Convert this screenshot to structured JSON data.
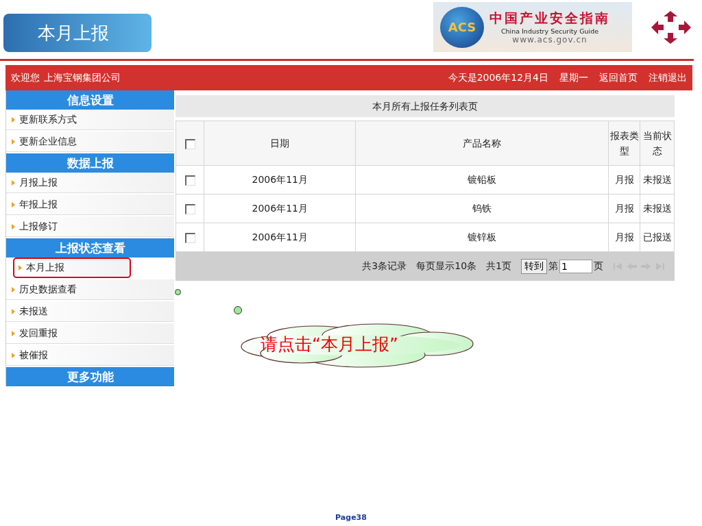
{
  "slide": {
    "title": "本月上报",
    "page": "Page38"
  },
  "logo": {
    "badge": "ACS",
    "title": "中国产业安全指南",
    "subtitle": "China Industry Security Guide",
    "url": "www.acs.gov.cn"
  },
  "header": {
    "welcome": "欢迎您",
    "company": "上海宝钢集团公司",
    "date": "今天是2006年12月4日",
    "weekday": "星期一",
    "links": [
      "返回首页",
      "注销退出"
    ]
  },
  "sidebar": {
    "sections": [
      {
        "title": "信息设置",
        "items": [
          {
            "label": "更新联系方式",
            "highlighted": false
          },
          {
            "label": "更新企业信息",
            "highlighted": false
          }
        ]
      },
      {
        "title": "数据上报",
        "items": [
          {
            "label": "月报上报",
            "highlighted": false
          },
          {
            "label": "年报上报",
            "highlighted": false
          },
          {
            "label": "上报修订",
            "highlighted": false
          }
        ]
      },
      {
        "title": "上报状态查看",
        "items": [
          {
            "label": "本月上报",
            "highlighted": true
          },
          {
            "label": "历史数据查看",
            "highlighted": false
          },
          {
            "label": "未报送",
            "highlighted": false
          },
          {
            "label": "发回重报",
            "highlighted": false
          },
          {
            "label": "被催报",
            "highlighted": false
          }
        ]
      },
      {
        "title": "更多功能"
      }
    ]
  },
  "table": {
    "title": "本月所有上报任务列表页",
    "header_checked": false,
    "columns": [
      "日期",
      "产品名称",
      "报表类型",
      "当前状态"
    ],
    "rows": [
      {
        "checked": false,
        "cells": [
          "2006年11月",
          "镀铅板",
          "月报",
          "未报送"
        ]
      },
      {
        "checked": false,
        "cells": [
          "2006年11月",
          "钨铁",
          "月报",
          "未报送"
        ]
      },
      {
        "checked": false,
        "cells": [
          "2006年11月",
          "镀锌板",
          "月报",
          "已报送"
        ]
      }
    ]
  },
  "pager": {
    "records": "共3条记录",
    "per_page": "每页显示10条",
    "pages": "共1页",
    "goto_button": "转到",
    "page_prefix": "第",
    "page_value": "1",
    "page_suffix": "页"
  },
  "callout": {
    "text": "请点击“本月上报”"
  }
}
